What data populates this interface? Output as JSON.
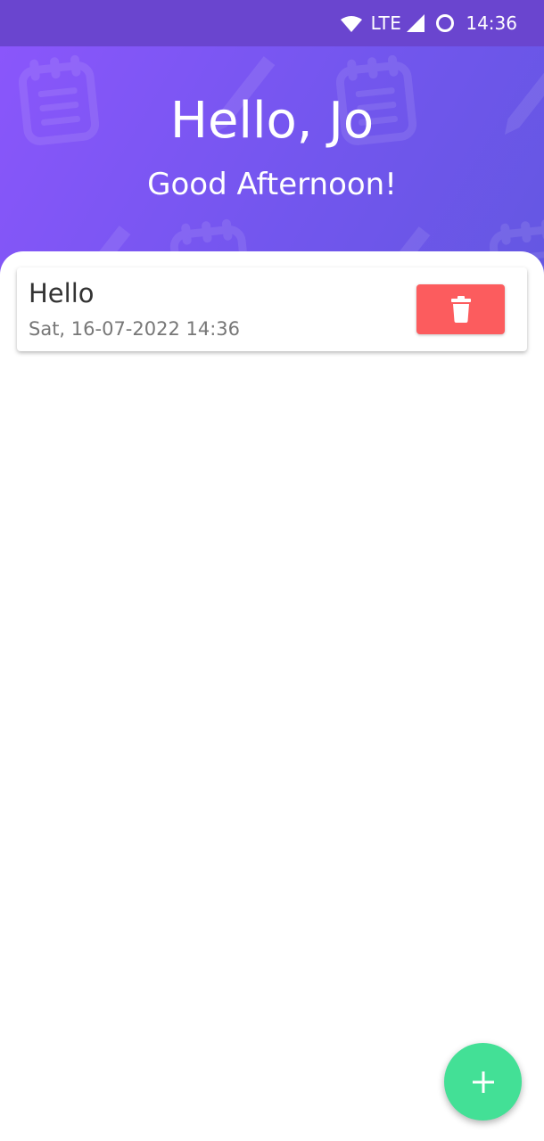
{
  "status_bar": {
    "network": "LTE",
    "time": "14:36",
    "icons": [
      "wifi-icon",
      "cell-signal-icon",
      "sync-circle-icon"
    ]
  },
  "header": {
    "greeting": "Hello, Jo",
    "subgreeting": "Good Afternoon!",
    "background_colors": [
      "#8a56fb",
      "#6457e2"
    ],
    "pattern_icons": [
      "notepad-icon",
      "pencil-icon"
    ]
  },
  "notes": [
    {
      "title": "Hello",
      "date": "Sat, 16-07-2022 14:36",
      "delete_icon": "trash-icon",
      "delete_color": "#fc5c5e"
    }
  ],
  "fab": {
    "icon": "plus-icon",
    "color": "#43e096"
  }
}
